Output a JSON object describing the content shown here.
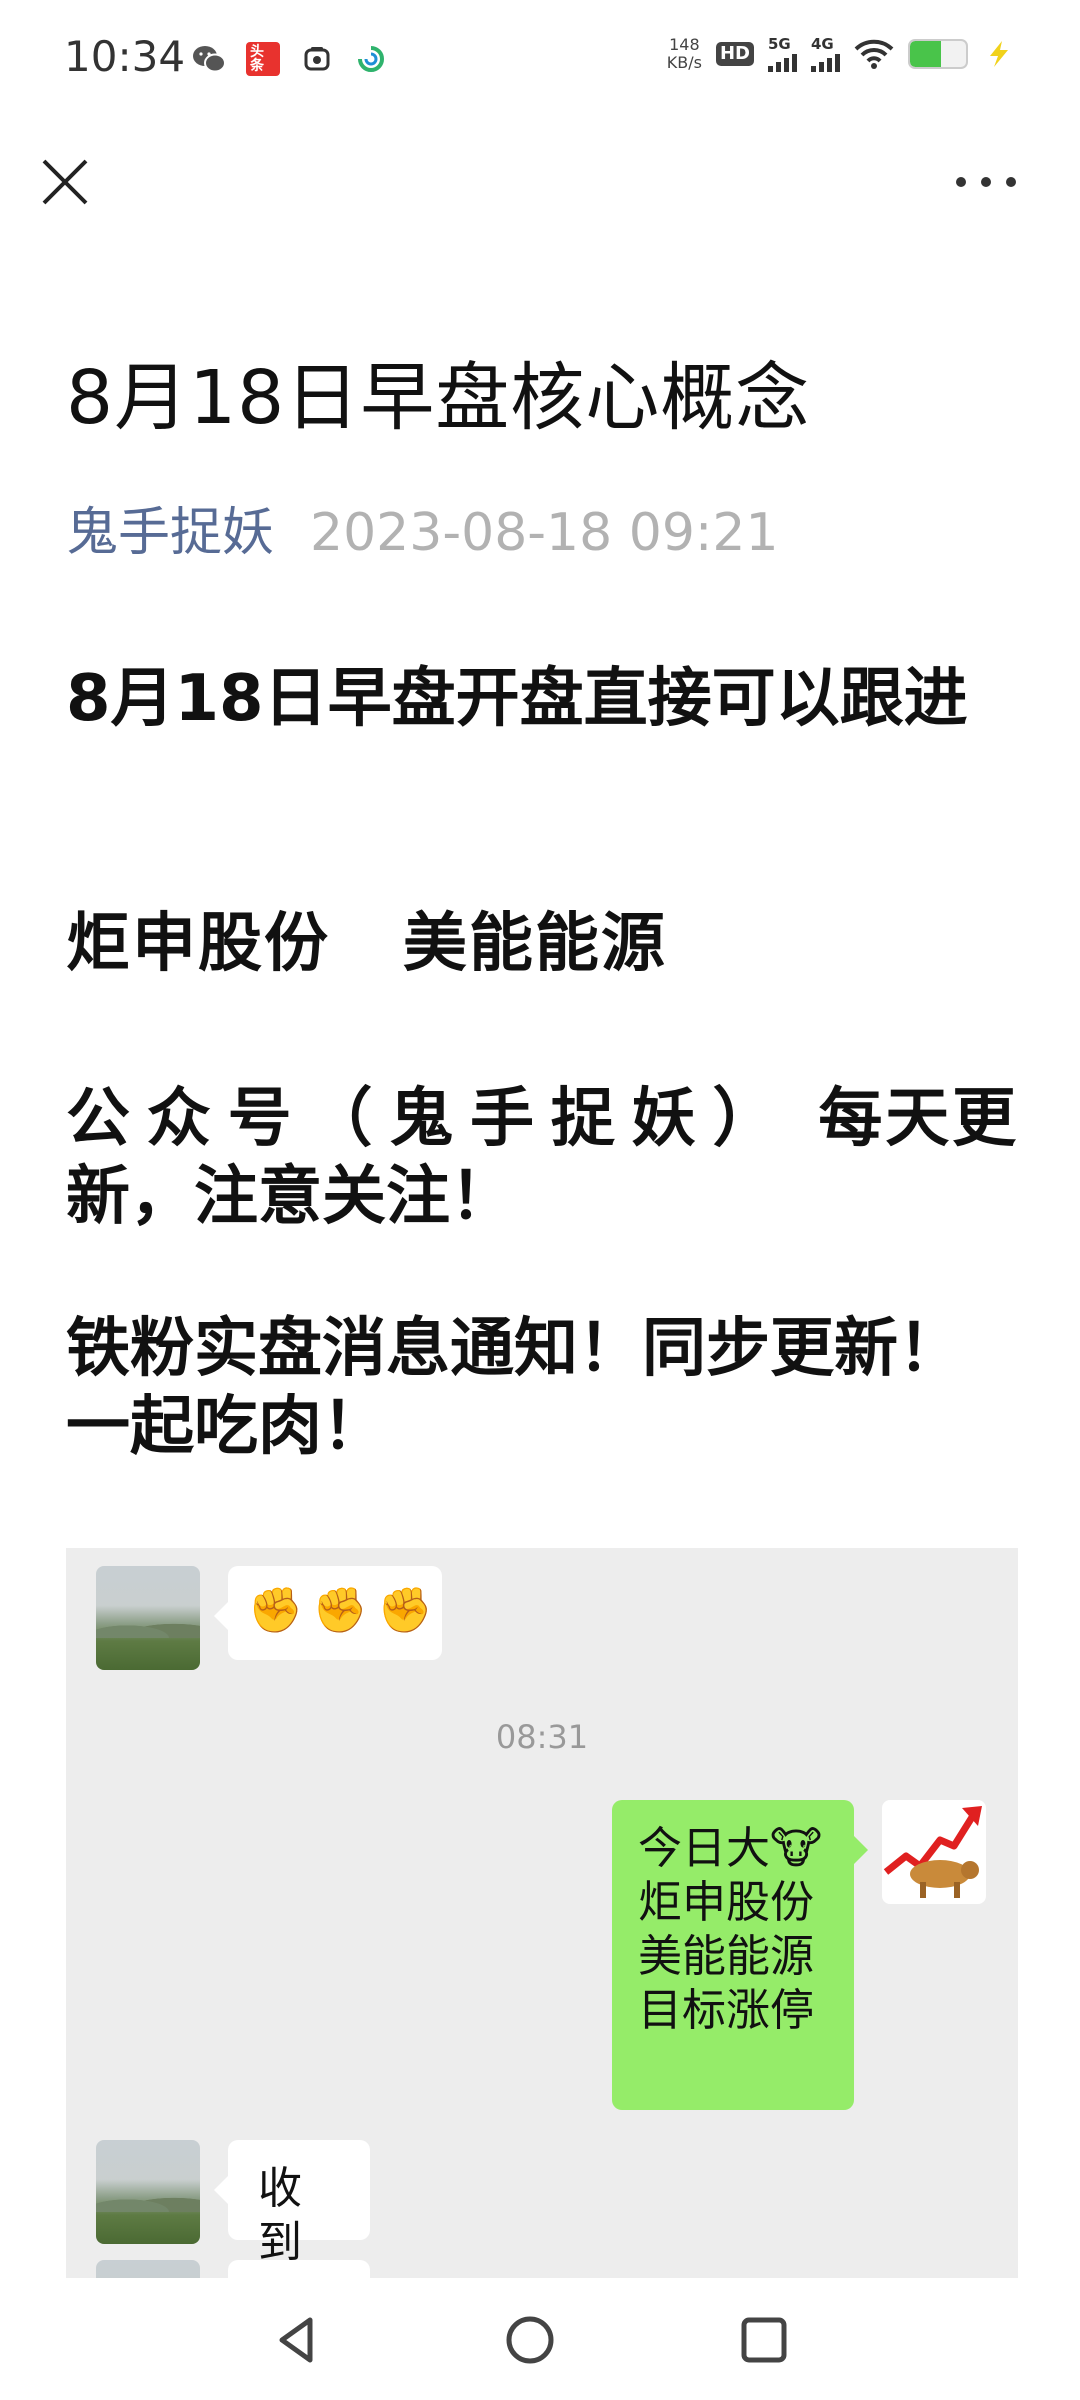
{
  "status_bar": {
    "time": "10:34",
    "net_speed_value": "148",
    "net_speed_unit": "KB/s",
    "hd_label": "HD",
    "sim1_label": "5G",
    "sim2_label": "4G",
    "battery_level": 0.55,
    "icons": [
      "wechat-icon",
      "toutiao-icon",
      "camera-app-icon",
      "refresh-app-icon",
      "wifi-icon",
      "battery-icon",
      "charging-icon"
    ],
    "toutiao_label": "头条"
  },
  "header": {
    "close_icon": "close-icon",
    "more_icon": "more-icon"
  },
  "article": {
    "title": "8月18日早盘核心概念",
    "author": "鬼手捉妖",
    "date": "2023-08-18 09:21",
    "para1": "8月18日早盘开盘直接可以跟进",
    "para2": "炬申股份   美能能源",
    "para3_a": "公众号（鬼手捉妖）",
    "para3_b": " 每天更新，注意关注！",
    "para4": "铁粉实盘消息通知！同步更新！一起吃肉！"
  },
  "chat_image": {
    "msg1_emoji": [
      "✊",
      "✊",
      "✊"
    ],
    "time": "08:31",
    "msg2_lines": [
      "今日大🐮",
      "炬申股份",
      "美能能源",
      "目标涨停"
    ],
    "msg3": "收到",
    "colors": {
      "background": "#ededed",
      "green_bubble": "#95ec69",
      "white_bubble": "#ffffff"
    }
  },
  "nav_bar": {
    "icons": [
      "back-icon",
      "home-icon",
      "recents-icon"
    ]
  }
}
